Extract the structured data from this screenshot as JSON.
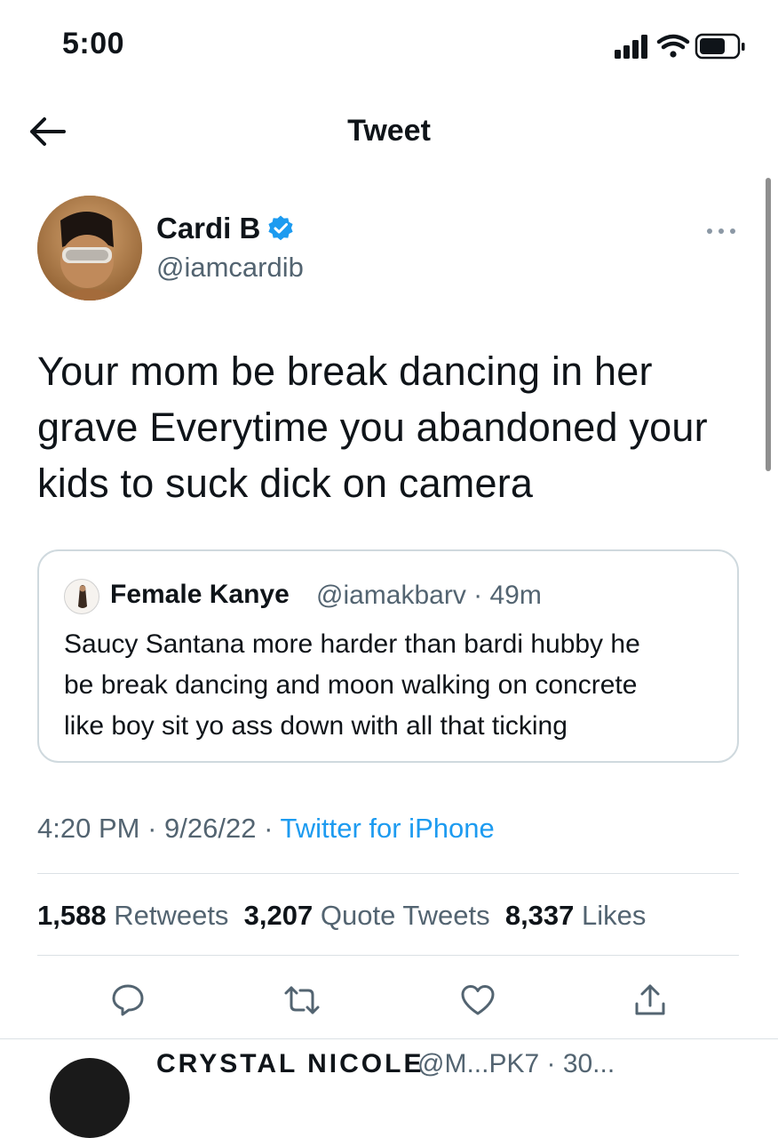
{
  "status_bar": {
    "time": "5:00",
    "icons": [
      "cellular-signal-icon",
      "wifi-icon",
      "battery-icon"
    ]
  },
  "header": {
    "title": "Tweet",
    "back_icon": "arrow-left-icon"
  },
  "tweet": {
    "author_name": "Cardi B",
    "author_handle": "@iamcardib",
    "verified": true,
    "text_lines": [
      "Your mom be break dancing in her",
      "grave Everytime you abandoned your",
      "kids to suck dick on camera"
    ],
    "quote": {
      "author_name": "Female Kanye",
      "author_handle": "@iamakbarv · 49m",
      "text_lines": [
        "Saucy Santana more harder than bardi hubby he",
        "be break dancing and moon walking on concrete",
        "like boy sit yo ass down with all that ticking"
      ]
    },
    "time": "4:20 PM",
    "date": "9/26/22",
    "separator": "·",
    "source": "Twitter for iPhone",
    "stats": {
      "retweets_count": "1,588",
      "retweets_label": "Retweets",
      "quote_tweets_count": "3,207",
      "quote_tweets_label": "Quote Tweets",
      "likes_count": "8,337",
      "likes_label": "Likes"
    },
    "actions": [
      "reply-icon",
      "retweet-icon",
      "like-icon",
      "share-icon"
    ]
  },
  "next_reply": {
    "name": "CRYSTAL NICOLE",
    "handle": "@M...PK7 · 30..."
  },
  "colors": {
    "text": "#0f1419",
    "secondary": "#536471",
    "link": "#1d9bf0",
    "verified": "#1d9bf0",
    "border": "#cfd9de"
  }
}
